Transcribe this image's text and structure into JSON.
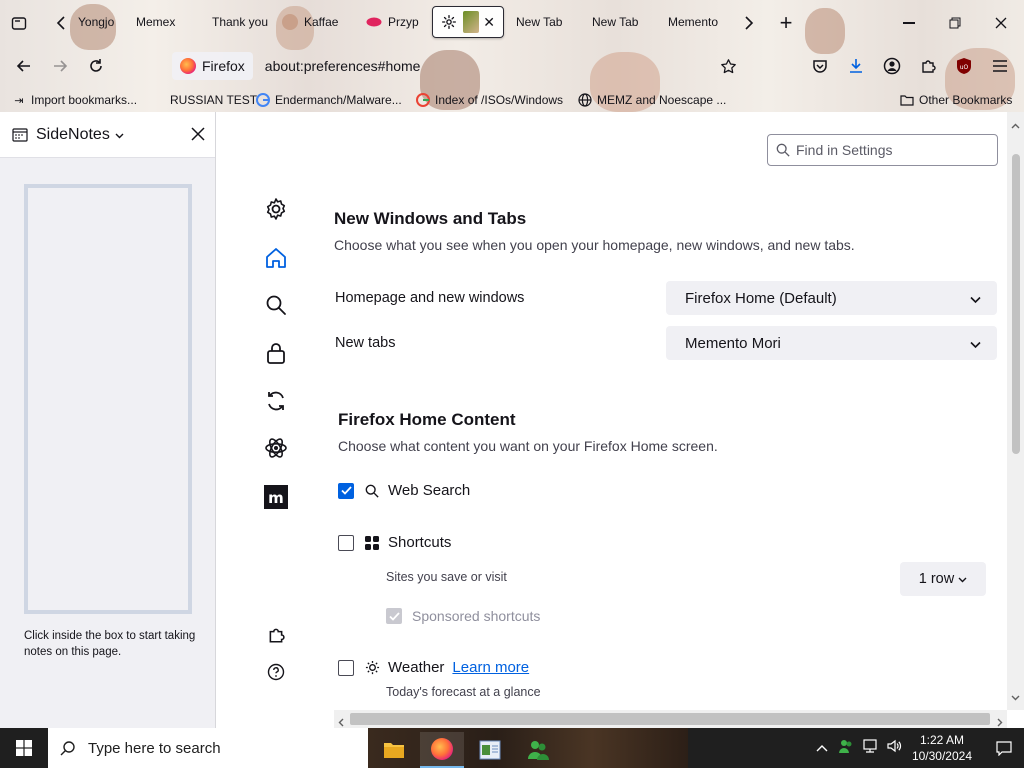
{
  "browser": {
    "tabs": [
      {
        "label": "Yongjo",
        "icon": "yongjo-tab-icon"
      },
      {
        "label": "Memex",
        "icon": "memex-tab-icon"
      },
      {
        "label": "Thank you",
        "icon": "thank-you-tab-icon"
      },
      {
        "label": "Kaffae",
        "icon": "kaffae-tab-icon"
      },
      {
        "label": "Przyp",
        "icon": "przyp-tab-icon"
      },
      {
        "label": "",
        "icon": "settings-tab-icon"
      },
      {
        "label": "New Tab",
        "icon": "new-tab-icon"
      },
      {
        "label": "New Tab",
        "icon": "new-tab-icon"
      },
      {
        "label": "Memento",
        "icon": "memento-tab-icon"
      }
    ],
    "identity_label": "Firefox",
    "url": "about:preferences#home",
    "bookmarks": [
      "Import bookmarks...",
      "RUSSIAN TEST",
      "Endermanch/Malware...",
      "Index of /ISOs/Windows",
      "MEMZ and Noescape ...",
      "Other Bookmarks"
    ]
  },
  "sidebar": {
    "title": "SideNotes",
    "help": "Click inside the box to start taking notes on this page."
  },
  "settings": {
    "find_placeholder": "Find in Settings",
    "new_windows": {
      "title": "New Windows and Tabs",
      "description": "Choose what you see when you open your homepage, new windows, and new tabs.",
      "homepage_label": "Homepage and new windows",
      "homepage_value": "Firefox Home (Default)",
      "newtabs_label": "New tabs",
      "newtabs_value": "Memento Mori"
    },
    "home_content": {
      "title": "Firefox Home Content",
      "description": "Choose what content you want on your Firefox Home screen.",
      "web_search": "Web Search",
      "web_search_checked": true,
      "shortcuts": "Shortcuts",
      "shortcuts_checked": false,
      "shortcuts_sub": "Sites you save or visit",
      "rows_value": "1 row",
      "sponsored": "Sponsored shortcuts",
      "weather": "Weather",
      "learn_more": "Learn more",
      "weather_sub": "Today's forecast at a glance"
    }
  },
  "taskbar": {
    "search_placeholder": "Type here to search",
    "time": "1:22 AM",
    "date": "10/30/2024"
  },
  "colors": {
    "accent": "#0061e0",
    "taskbar": "#1f1f1f"
  }
}
